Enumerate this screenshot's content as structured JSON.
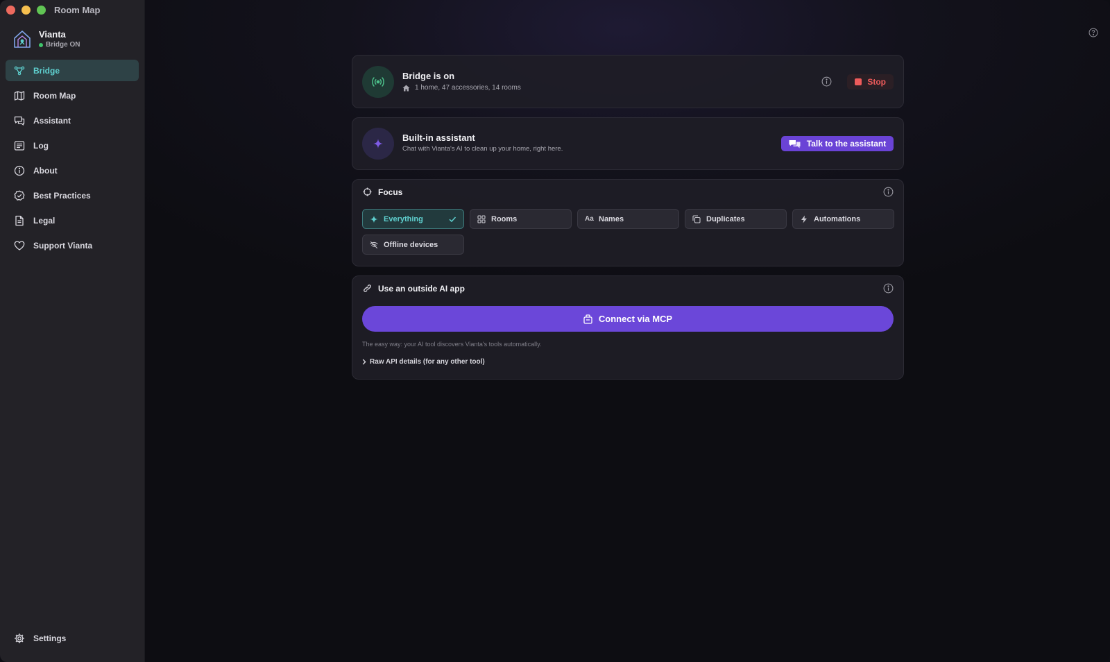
{
  "window": {
    "title": "Room Map"
  },
  "brand": {
    "name": "Vianta",
    "status": "Bridge ON"
  },
  "sidebar": {
    "items": [
      {
        "label": "Bridge",
        "icon": "bridge-icon",
        "active": true
      },
      {
        "label": "Room Map",
        "icon": "map-icon"
      },
      {
        "label": "Assistant",
        "icon": "chat-icon"
      },
      {
        "label": "Log",
        "icon": "list-icon"
      },
      {
        "label": "About",
        "icon": "info-icon"
      },
      {
        "label": "Best Practices",
        "icon": "badge-check-icon"
      },
      {
        "label": "Legal",
        "icon": "document-icon"
      },
      {
        "label": "Support Vianta",
        "icon": "heart-icon"
      }
    ],
    "settings_label": "Settings"
  },
  "bridge": {
    "title": "Bridge is on",
    "summary": "1 home, 47 accessories, 14 rooms",
    "stop_label": "Stop"
  },
  "assistant": {
    "title": "Built-in assistant",
    "subtitle": "Chat with Vianta's AI to clean up your home, right here.",
    "button_label": "Talk to the assistant"
  },
  "focus": {
    "title": "Focus",
    "options": [
      {
        "label": "Everything",
        "icon": "sparkle-icon",
        "selected": true
      },
      {
        "label": "Rooms",
        "icon": "grid-icon"
      },
      {
        "label": "Names",
        "icon": "text-icon",
        "glyph": "Aa"
      },
      {
        "label": "Duplicates",
        "icon": "copy-icon"
      },
      {
        "label": "Automations",
        "icon": "bolt-icon"
      },
      {
        "label": "Offline devices",
        "icon": "wifi-off-icon"
      }
    ]
  },
  "outside_ai": {
    "title": "Use an outside AI app",
    "button_label": "Connect via MCP",
    "hint": "The easy way: your AI tool discovers Vianta's tools automatically.",
    "raw_label": "Raw API details (for any other tool)"
  },
  "colors": {
    "accent_teal": "#5fd0cf",
    "accent_purple": "#6b47d9",
    "stop_red": "#ef5b5b",
    "status_green": "#3fc46b"
  }
}
